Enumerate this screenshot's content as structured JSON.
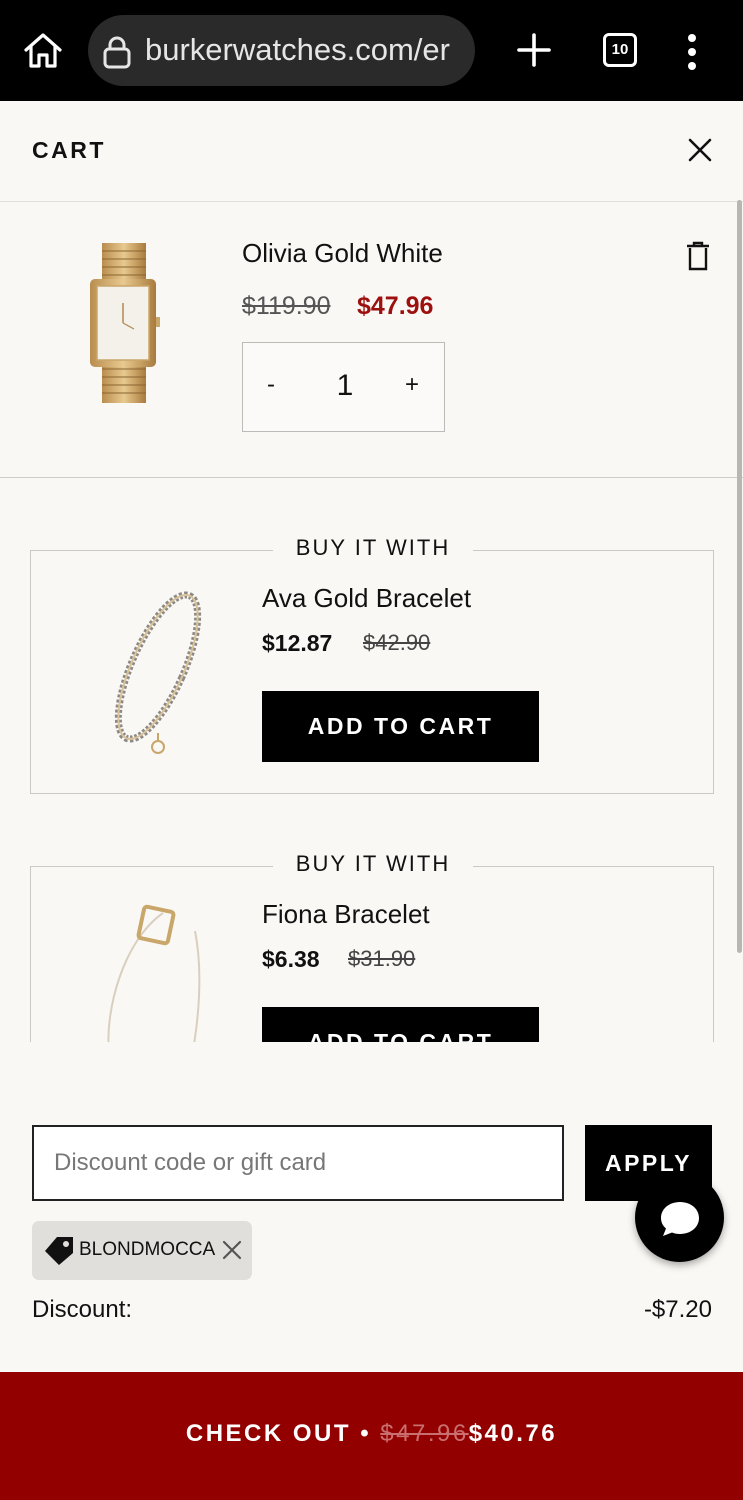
{
  "browser": {
    "url": "burkerwatches.com/er",
    "tab_count": "10"
  },
  "cart": {
    "title": "CART",
    "item": {
      "name": "Olivia Gold White",
      "compare_price": "$119.90",
      "price": "$47.96",
      "quantity": "1",
      "minus": "-",
      "plus": "+"
    }
  },
  "upsells": [
    {
      "heading": "BUY IT WITH",
      "name": "Ava Gold Bracelet",
      "price": "$12.87",
      "compare_price": "$42.90",
      "button": "ADD TO CART"
    },
    {
      "heading": "BUY IT WITH",
      "name": "Fiona Bracelet",
      "price": "$6.38",
      "compare_price": "$31.90",
      "button": "ADD TO CART"
    }
  ],
  "discount": {
    "placeholder": "Discount code or gift card",
    "apply": "APPLY",
    "code": "BLONDMOCCA",
    "label": "Discount:",
    "amount": "-$7.20"
  },
  "checkout": {
    "label": "CHECK OUT",
    "separator": "•",
    "compare_total": "$47.96",
    "total": "$40.76"
  },
  "colors": {
    "accent_red": "#930000",
    "sale_price": "#9c1010",
    "background": "#faf8f5"
  }
}
